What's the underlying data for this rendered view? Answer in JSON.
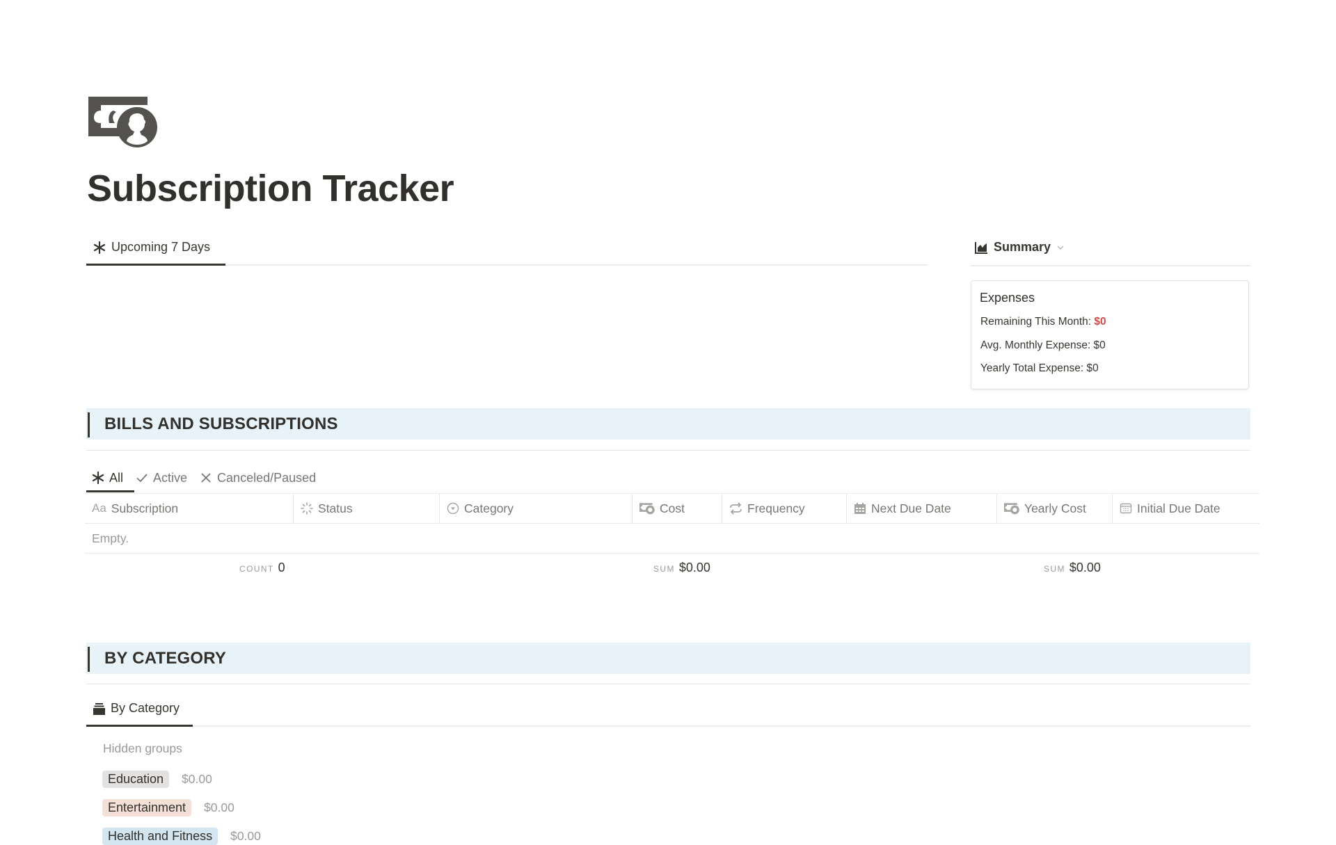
{
  "page": {
    "icon": "money-icon",
    "title": "Subscription Tracker"
  },
  "upcoming": {
    "tab_label": "Upcoming 7 Days",
    "tab_icon": "asterisk-icon"
  },
  "summary": {
    "tab_label": "Summary",
    "tab_icon": "chart-icon",
    "card_title": "Expenses",
    "remaining_label": "Remaining This Month: ",
    "remaining_value": "$0",
    "avg_label": "Avg. Monthly Expense: $0",
    "yearly_label": "Yearly Total Expense: $0",
    "accent_color": "#d44c47"
  },
  "bills": {
    "heading": "BILLS AND SUBSCRIPTIONS",
    "tabs": [
      {
        "label": "All",
        "icon": "asterisk-icon",
        "active": true
      },
      {
        "label": "Active",
        "icon": "check-icon",
        "active": false
      },
      {
        "label": "Canceled/Paused",
        "icon": "x-icon",
        "active": false
      }
    ],
    "columns": [
      {
        "label": "Subscription",
        "icon": "text-icon"
      },
      {
        "label": "Status",
        "icon": "status-icon"
      },
      {
        "label": "Category",
        "icon": "select-icon"
      },
      {
        "label": "Cost",
        "icon": "money-icon"
      },
      {
        "label": "Frequency",
        "icon": "repeat-icon"
      },
      {
        "label": "Next Due Date",
        "icon": "calendar-icon"
      },
      {
        "label": "Yearly Cost",
        "icon": "money-icon"
      },
      {
        "label": "Initial Due Date",
        "icon": "calendar-outline-icon"
      }
    ],
    "empty_text": "Empty.",
    "footer": {
      "count_label": "COUNT",
      "count_value": "0",
      "cost_sum_label": "SUM",
      "cost_sum_value": "$0.00",
      "yearly_sum_label": "SUM",
      "yearly_sum_value": "$0.00"
    }
  },
  "by_category": {
    "heading": "BY CATEGORY",
    "tab_label": "By Category",
    "tab_icon": "stack-icon",
    "hidden_groups_label": "Hidden groups",
    "groups": [
      {
        "label": "Education",
        "sum": "$0.00",
        "color": "#e3e2e0"
      },
      {
        "label": "Entertainment",
        "sum": "$0.00",
        "color": "#f5e0d8"
      },
      {
        "label": "Health and Fitness",
        "sum": "$0.00",
        "color": "#d3e5ef"
      }
    ]
  }
}
